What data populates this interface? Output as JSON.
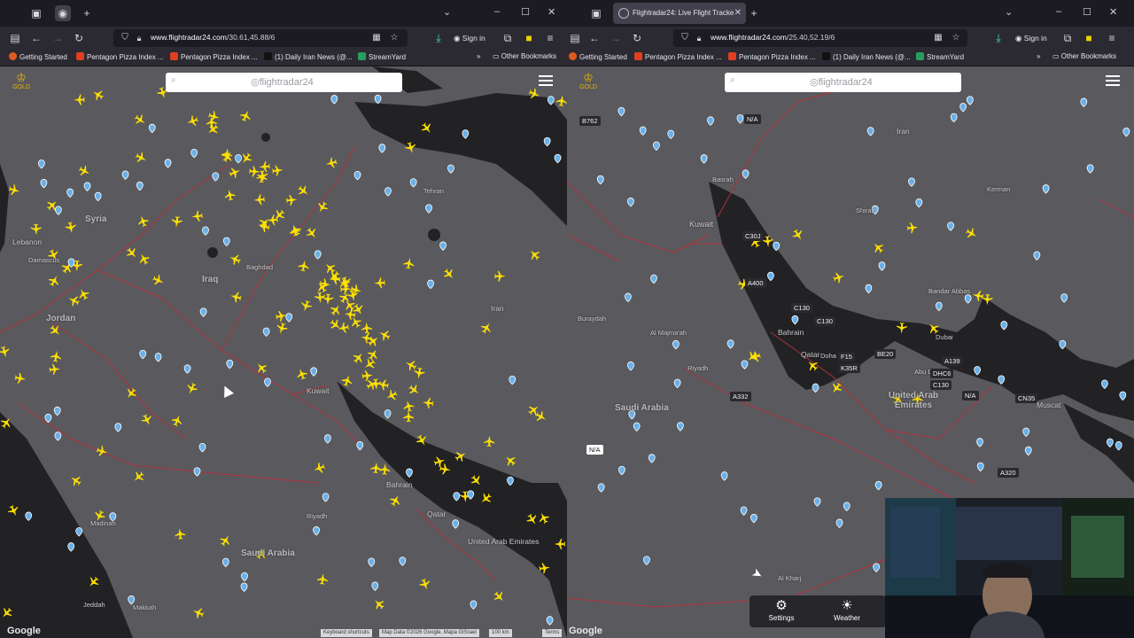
{
  "left": {
    "tab_title": "",
    "url_domain": "www.flightradar24.com",
    "url_path": "/30.61,45.88/6",
    "signin": "Sign in",
    "bookmarks": [
      "Getting Started",
      "Pentagon Pizza Index ...",
      "Pentagon Pizza Index ...",
      "(1) Daily Iran News (@...",
      "StreamYard"
    ],
    "other_bookmarks": "Other Bookmarks",
    "search_logo": "flightradar24",
    "gold": "GOLD",
    "countries": [
      "Syria",
      "Iraq",
      "Jordan",
      "Lebanon",
      "Kuwait",
      "Saudi Arabia",
      "Bahrain",
      "Qatar",
      "United Arab Emirates",
      "Iran"
    ],
    "cities": [
      "Damascus",
      "Baghdad",
      "Madinah",
      "Jeddah",
      "Makkah",
      "Riyadh",
      "Tehran"
    ],
    "attribution": [
      "Keyboard shortcuts",
      "Map Data ©2026 Google, Mapa GISrael",
      "100 km",
      "Terms"
    ],
    "google": "Google"
  },
  "right": {
    "tab_title": "Flightradar24: Live Flight Tracke",
    "url_domain": "www.flightradar24.com",
    "url_path": "/25.40,52.19/6",
    "signin": "Sign in",
    "bookmarks": [
      "Getting Started",
      "Pentagon Pizza Index ...",
      "Pentagon Pizza Index ...",
      "(1) Daily Iran News (@...",
      "StreamYard"
    ],
    "other_bookmarks": "Other Bookmarks",
    "search_logo": "flightradar24",
    "gold": "GOLD",
    "countries": [
      "Kuwait",
      "Saudi Arabia",
      "United Arab Emirates",
      "Bahrain",
      "Qatar",
      "Iran"
    ],
    "cities": [
      "Basrah",
      "Shiraz",
      "Kerman",
      "Bandar Abbas",
      "Riyadh",
      "Al Majma'ah",
      "Doha",
      "Muscat",
      "Dubai",
      "Abu Dhabi",
      "Buraydah",
      "Al Kharj"
    ],
    "flight_tags": [
      "B762",
      "N/A",
      "C30J",
      "A400",
      "C130",
      "C130",
      "F15",
      "K35R",
      "BE20",
      "A139",
      "DHC6",
      "C130",
      "N/A",
      "CN35",
      "A332",
      "A320",
      "N/A"
    ],
    "settings": "Settings",
    "weather": "Weather",
    "google": "Google"
  },
  "colors": {
    "plane": "#ffe000",
    "water": "#222224",
    "land": "#5c5c60",
    "border": "#b0303a",
    "pin": "#6ab0e8"
  }
}
